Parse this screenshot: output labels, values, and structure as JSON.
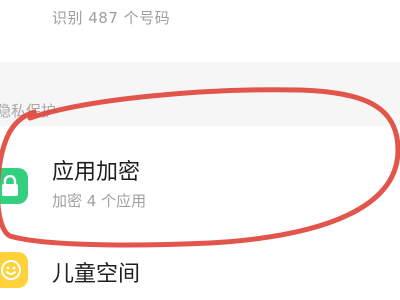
{
  "previous_item": {
    "subtitle": "识别 487 个号码"
  },
  "section": {
    "title": "隐私保护"
  },
  "app_lock": {
    "title": "应用加密",
    "subtitle": "加密 4 个应用",
    "icon": "lock-icon"
  },
  "kids_space": {
    "title": "儿童空间",
    "icon": "kids-face-icon"
  },
  "colors": {
    "app_lock_icon_bg": "#35d07f",
    "kids_icon_bg": "#ffd23a",
    "annotation_stroke": "#e0463c"
  }
}
